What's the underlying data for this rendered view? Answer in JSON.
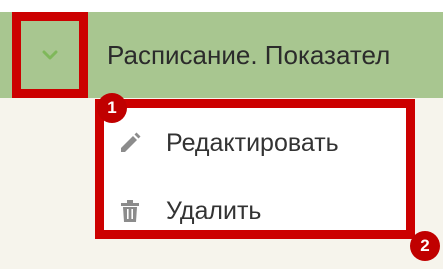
{
  "header": {
    "title": "Расписание. Показател"
  },
  "menu": {
    "items": [
      {
        "label": "Редактировать",
        "icon": "pencil-icon"
      },
      {
        "label": "Удалить",
        "icon": "trash-icon"
      }
    ]
  },
  "callouts": [
    "1",
    "2"
  ],
  "colors": {
    "header_bg": "#a8c690",
    "highlight_border": "#cc0000",
    "callout_bg": "#c00000",
    "icon_gray": "#8c8c8c"
  }
}
